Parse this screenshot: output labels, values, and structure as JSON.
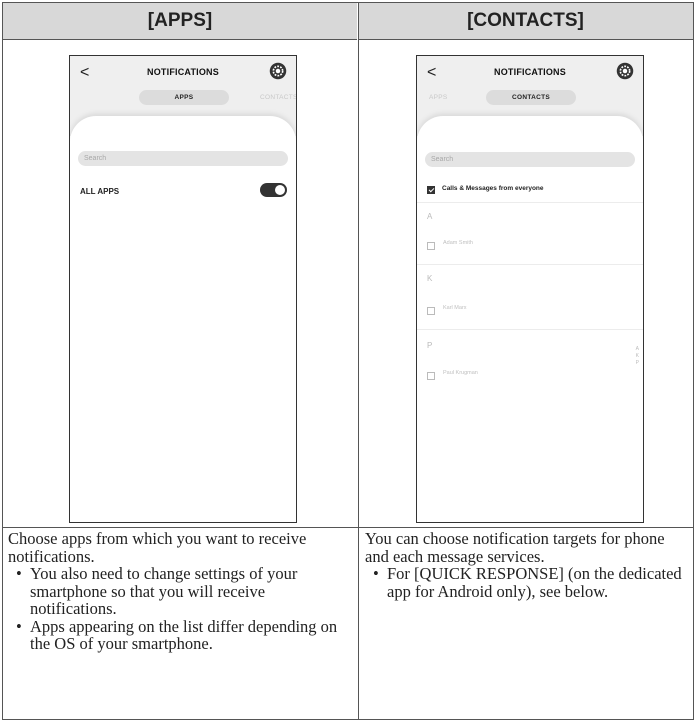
{
  "headers": {
    "left": "[APPS]",
    "right": "[CONTACTS]"
  },
  "apps_screen": {
    "back_glyph": "<",
    "title": "NOTIFICATIONS",
    "tab_active": "APPS",
    "tab_inactive": "CONTACTS",
    "search_placeholder": "Search",
    "all_apps_label": "ALL APPS",
    "all_apps_toggle_on": true
  },
  "contacts_screen": {
    "back_glyph": "<",
    "title": "NOTIFICATIONS",
    "tab_inactive": "APPS",
    "tab_active": "CONTACTS",
    "search_placeholder": "Search",
    "everyone_label": "Calls & Messages from everyone",
    "everyone_checked": true,
    "groups": [
      {
        "letter": "A",
        "contacts": [
          "Adam Smith"
        ]
      },
      {
        "letter": "K",
        "contacts": [
          "Karl Marx"
        ]
      },
      {
        "letter": "P",
        "contacts": [
          "Paul Krugman"
        ]
      }
    ],
    "index_letters": [
      "A",
      "K",
      "P"
    ]
  },
  "descriptions": {
    "left": {
      "intro": "Choose apps from which you want to receive notifications.",
      "bullets": [
        "You also need to change settings of your smartphone so that you will receive notifications.",
        "Apps appearing on the list differ depending on the OS of your smartphone."
      ]
    },
    "right": {
      "intro": "You can choose notification targets for phone and each message services.",
      "bullets": [
        "For [QUICK RESPONSE] (on the dedicated app for Android only), see below."
      ]
    }
  },
  "icons": {
    "settings": "gear-icon",
    "back": "chevron-left-icon",
    "check": "checkmark-icon"
  },
  "colors": {
    "header_bg": "#d8d8d8",
    "toggle_on": "#333333",
    "border": "#555555"
  }
}
